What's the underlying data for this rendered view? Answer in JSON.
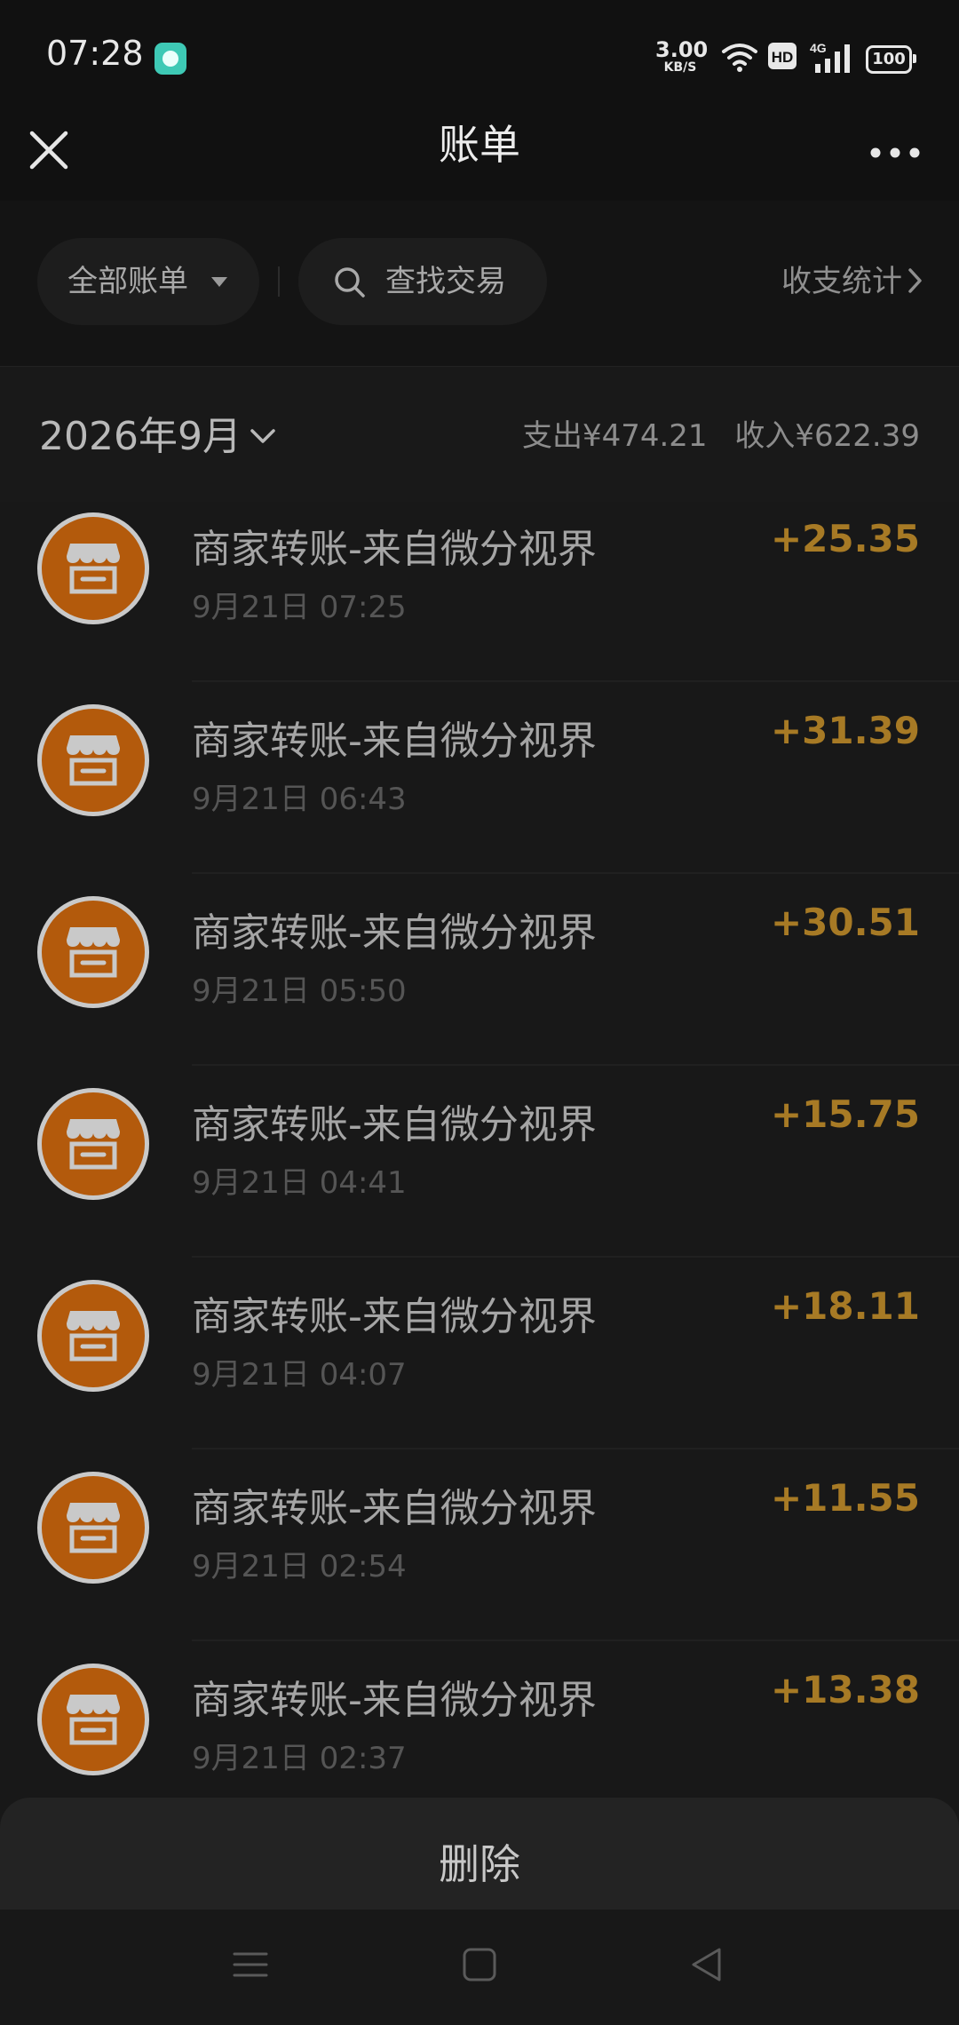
{
  "status_bar": {
    "time": "07:28",
    "network_speed_value": "3.00",
    "network_speed_unit": "KB/S",
    "hd_label": "HD",
    "network_type": "4G",
    "battery": "100"
  },
  "header": {
    "title": "账单"
  },
  "filters": {
    "all_bills_label": "全部账单",
    "search_placeholder": "查找交易",
    "stats_label": "收支统计"
  },
  "month": {
    "label": "2026年9月",
    "expense": "支出¥474.21",
    "income": "收入¥622.39"
  },
  "transactions": [
    {
      "title": "商家转账-来自微分视界",
      "time": "9月21日 07:25",
      "amount": "+25.35"
    },
    {
      "title": "商家转账-来自微分视界",
      "time": "9月21日 06:43",
      "amount": "+31.39"
    },
    {
      "title": "商家转账-来自微分视界",
      "time": "9月21日 05:50",
      "amount": "+30.51"
    },
    {
      "title": "商家转账-来自微分视界",
      "time": "9月21日 04:41",
      "amount": "+15.75"
    },
    {
      "title": "商家转账-来自微分视界",
      "time": "9月21日 04:07",
      "amount": "+18.11"
    },
    {
      "title": "商家转账-来自微分视界",
      "time": "9月21日 02:54",
      "amount": "+11.55"
    },
    {
      "title": "商家转账-来自微分视界",
      "time": "9月21日 02:37",
      "amount": "+13.38"
    }
  ],
  "sheet": {
    "delete_label": "删除"
  },
  "colors": {
    "background": "#181818",
    "amount": "#a77a25",
    "avatar": "#b35a0c",
    "app_icon": "#3ec9b5"
  },
  "icons": {
    "close": "close-icon",
    "more": "more-icon",
    "search": "search-icon",
    "chevron_right": "chevron-right-icon",
    "chevron_down": "chevron-down-icon",
    "merchant": "shop-icon"
  }
}
